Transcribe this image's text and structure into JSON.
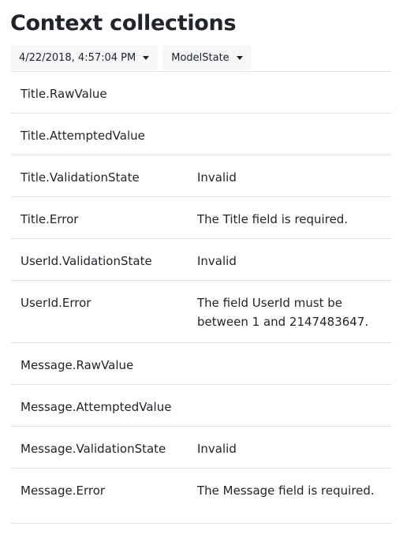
{
  "page": {
    "title": "Context collections"
  },
  "toolbar": {
    "timestamp_dropdown": {
      "label": "4/22/2018, 4:57:04 PM",
      "icon": "chevron-down-icon"
    },
    "collection_dropdown": {
      "label": "ModelState",
      "icon": "chevron-down-icon"
    }
  },
  "table": {
    "rows": [
      {
        "key": "Title.RawValue",
        "value": ""
      },
      {
        "key": "Title.AttemptedValue",
        "value": ""
      },
      {
        "key": "Title.ValidationState",
        "value": "Invalid"
      },
      {
        "key": "Title.Error",
        "value": "The Title field is required."
      },
      {
        "key": "UserId.ValidationState",
        "value": "Invalid"
      },
      {
        "key": "UserId.Error",
        "value": "The field UserId must be between 1 and 2147483647."
      },
      {
        "key": "Message.RawValue",
        "value": ""
      },
      {
        "key": "Message.AttemptedValue",
        "value": ""
      },
      {
        "key": "Message.ValidationState",
        "value": "Invalid"
      },
      {
        "key": "Message.Error",
        "value": "The Message field is required."
      }
    ]
  },
  "colors": {
    "text": "#212529",
    "dropdown_bg": "#f6f7f8",
    "divider": "#dee2e6"
  }
}
